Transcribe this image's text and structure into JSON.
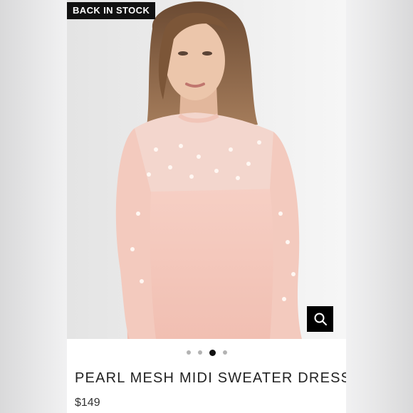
{
  "badge": {
    "label": "BACK IN STOCK"
  },
  "product": {
    "title": "PEARL MESH MIDI SWEATER DRESS",
    "price": "$149"
  },
  "gallery": {
    "dots": [
      {
        "active": false
      },
      {
        "active": false
      },
      {
        "active": true
      },
      {
        "active": false
      }
    ]
  },
  "icons": {
    "zoom": "magnifier-icon"
  },
  "colors": {
    "dress": "#f4c3b8",
    "badge_bg": "#111111",
    "active_dot": "#111111"
  }
}
